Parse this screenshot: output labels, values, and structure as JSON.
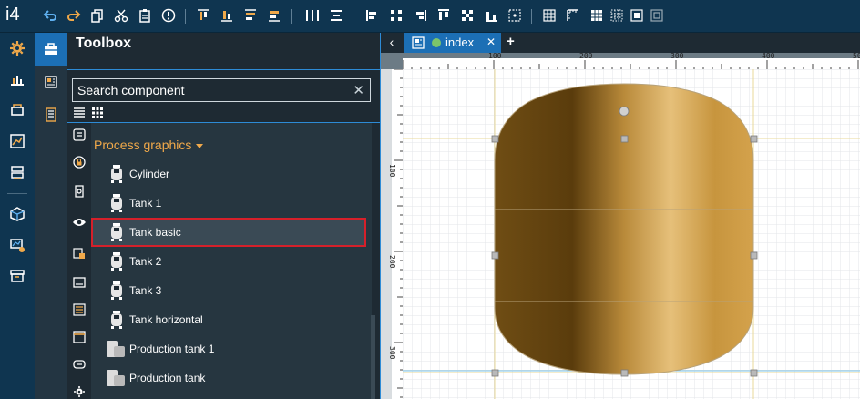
{
  "app": {
    "logo": "i4"
  },
  "toolbox": {
    "title": "Toolbox",
    "search_placeholder": "Search component",
    "search_clear": "✕",
    "group": "Process graphics",
    "components": [
      {
        "label": "Cylinder"
      },
      {
        "label": "Tank 1"
      },
      {
        "label": "Tank basic"
      },
      {
        "label": "Tank 2"
      },
      {
        "label": "Tank 3"
      },
      {
        "label": "Tank horizontal"
      },
      {
        "label": "Production tank 1"
      },
      {
        "label": "Production tank"
      }
    ]
  },
  "tabs": {
    "back": "‹",
    "active": {
      "name": "index",
      "close": "✕"
    },
    "add": "+"
  },
  "rulers": {
    "top": [
      "100",
      "200",
      "300",
      "400",
      "50"
    ],
    "left": [
      "100",
      "200",
      "300"
    ]
  },
  "colors": {
    "accent": "#1c6fb5",
    "toolbar": "#0f3550",
    "group_title": "#f0a94a",
    "selection": "#d6202a",
    "tank_gold": "#c99a45"
  }
}
